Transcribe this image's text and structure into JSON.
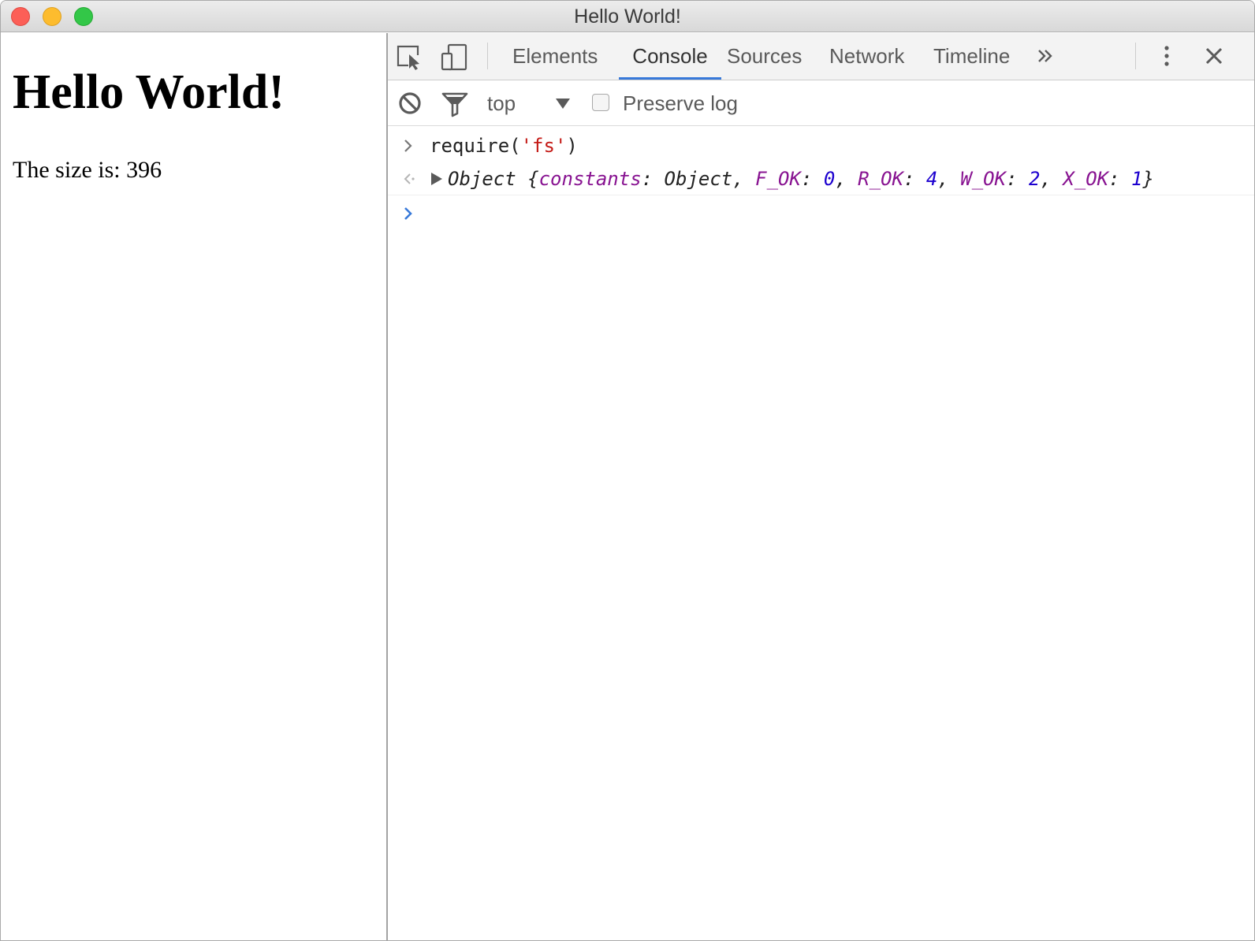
{
  "window": {
    "title": "Hello World!"
  },
  "page": {
    "heading": "Hello World!",
    "size_text": "The size is: 396"
  },
  "devtools": {
    "tabs": {
      "elements": "Elements",
      "console": "Console",
      "sources": "Sources",
      "network": "Network",
      "timeline": "Timeline"
    },
    "toolbar": {
      "context": "top",
      "preserve_log_label": "Preserve log",
      "preserve_log_checked": false
    },
    "console": {
      "input": {
        "fn": "require(",
        "arg": "'fs'",
        "close": ")"
      },
      "result": {
        "prefix": "Object {",
        "k1": "constants",
        "v1": "Object",
        "k2": "F_OK",
        "v2": "0",
        "k3": "R_OK",
        "v3": "4",
        "k4": "W_OK",
        "v4": "2",
        "k5": "X_OK",
        "v5": "1",
        "suffix": "}"
      }
    }
  },
  "colors": {
    "active_tab_underline": "#3879d9",
    "string": "#c41a16",
    "property": "#881391",
    "number": "#1c00cf",
    "prompt": "#3879d9"
  }
}
